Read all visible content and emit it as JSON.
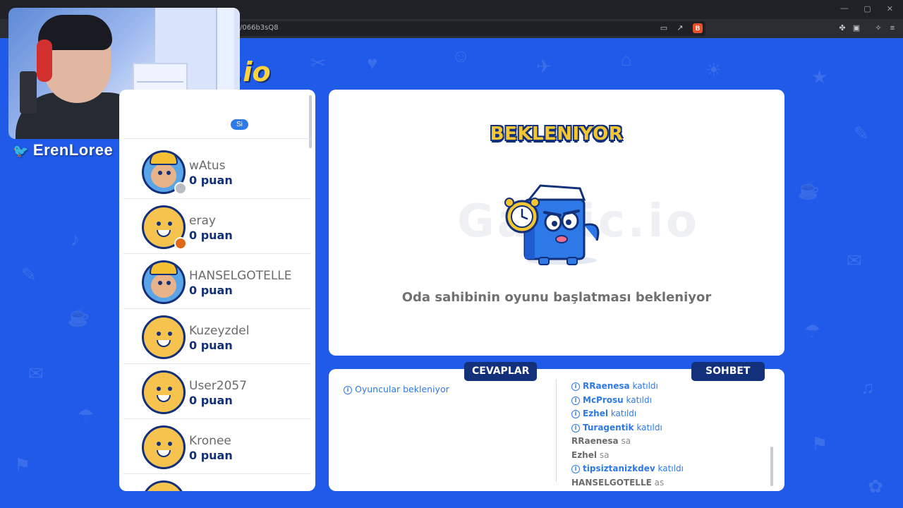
{
  "browser": {
    "url_fragment": "/066b3sQ8",
    "brave_badge": "B",
    "window_controls": [
      "—",
      "▢",
      "✕"
    ]
  },
  "streamer": {
    "handle": "ErenLoree"
  },
  "logo_text": ".io",
  "players": [
    {
      "name": "",
      "score": "",
      "badge": "Si",
      "avatar": "cap"
    },
    {
      "name": "wAtus",
      "score": "0 puan",
      "avatar": "cap",
      "status": "#b9bcc2"
    },
    {
      "name": "eray",
      "score": "0 puan",
      "avatar": "smile",
      "status": "#e0691a"
    },
    {
      "name": "HANSELGOTELLE",
      "score": "0 puan",
      "avatar": "cap"
    },
    {
      "name": "Kuzeyzdel",
      "score": "0 puan",
      "avatar": "smile"
    },
    {
      "name": "User2057",
      "score": "0 puan",
      "avatar": "smile"
    },
    {
      "name": "Kronee",
      "score": "0 puan",
      "avatar": "smile"
    }
  ],
  "waiting": {
    "title": "BEKLENIYOR",
    "watermark": "Gartic.io",
    "message": "Oda sahibinin oyunu başlatması bekleniyor"
  },
  "answers": {
    "tab_label": "CEVAPLAR",
    "message": "Oyuncular bekleniyor"
  },
  "chat": {
    "tab_label": "SOHBET",
    "lines": [
      {
        "type": "join",
        "who": "RRaenesa",
        "what": "katıldı"
      },
      {
        "type": "join",
        "who": "McProsu",
        "what": "katıldı"
      },
      {
        "type": "join",
        "who": "Ezhel",
        "what": "katıldı"
      },
      {
        "type": "join",
        "who": "Turagentik",
        "what": "katıldı"
      },
      {
        "type": "msg",
        "who": "RRaenesa",
        "what": "sa"
      },
      {
        "type": "msg",
        "who": "Ezhel",
        "what": "sa"
      },
      {
        "type": "join",
        "who": "tipsiztanizkdev",
        "what": "katıldı"
      },
      {
        "type": "msg",
        "who": "HANSELGOTELLE",
        "what": "as"
      }
    ]
  },
  "colors": {
    "background": "#1f5ae8",
    "navy": "#13307a",
    "accent_blue": "#2e79e8",
    "yellow": "#f4c632"
  }
}
